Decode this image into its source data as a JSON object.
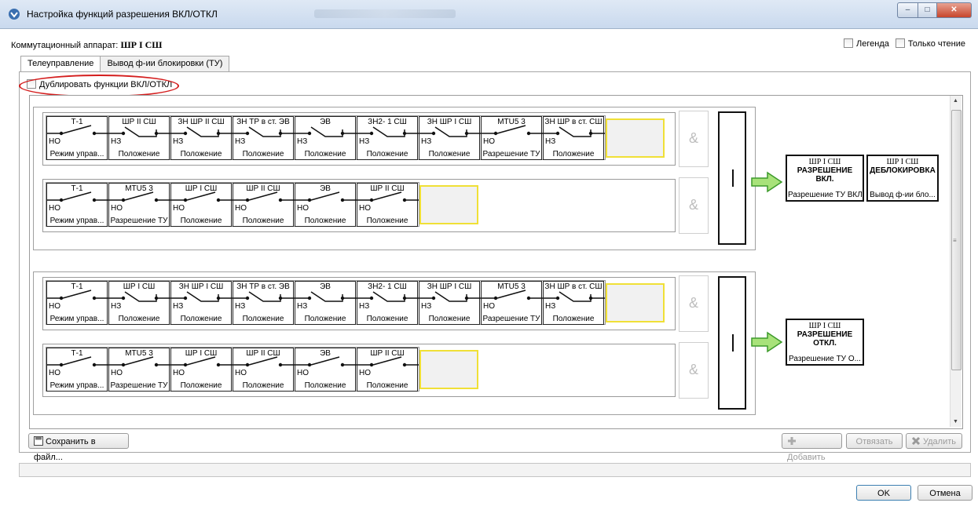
{
  "window": {
    "title": "Настройка функций разрешения ВКЛ/ОТКЛ"
  },
  "header": {
    "device_label": "Коммутационный аппарат:",
    "device_value": "ШР I СШ",
    "legend": "Легенда",
    "readonly": "Только чтение"
  },
  "tabs": [
    "Телеуправление",
    "Вывод ф-ии блокировки (ТУ)"
  ],
  "duplicate_label": "Дублировать функции ВКЛ/ОТКЛ",
  "and_symbol": "&",
  "groups": [
    {
      "rows": [
        {
          "switches": [
            {
              "name": "Т-1",
              "type": "НО",
              "desc": "Режим управ...",
              "state": "open"
            },
            {
              "name": "ШР II СШ",
              "type": "НЗ",
              "desc": "Положение",
              "state": "closed"
            },
            {
              "name": "ЗН ШР II СШ",
              "type": "НЗ",
              "desc": "Положение",
              "state": "closed"
            },
            {
              "name": "ЗН ТР в ст. ЭВ",
              "type": "НЗ",
              "desc": "Положение",
              "state": "closed"
            },
            {
              "name": "ЭВ",
              "type": "НЗ",
              "desc": "Положение",
              "state": "closed"
            },
            {
              "name": "ЗН2- 1 СШ",
              "type": "НЗ",
              "desc": "Положение",
              "state": "closed"
            },
            {
              "name": "ЗН ШР I СШ",
              "type": "НЗ",
              "desc": "Положение",
              "state": "closed"
            },
            {
              "name": "MTU5 3",
              "type": "НО",
              "desc": "Разрешение ТУ",
              "state": "open"
            },
            {
              "name": "ЗН ШР в ст. СШ",
              "type": "НЗ",
              "desc": "Положение",
              "state": "closed"
            }
          ]
        },
        {
          "switches": [
            {
              "name": "Т-1",
              "type": "НО",
              "desc": "Режим управ...",
              "state": "open"
            },
            {
              "name": "MTU5 3",
              "type": "НО",
              "desc": "Разрешение ТУ",
              "state": "open"
            },
            {
              "name": "ШР I СШ",
              "type": "НО",
              "desc": "Положение",
              "state": "open"
            },
            {
              "name": "ШР II СШ",
              "type": "НО",
              "desc": "Положение",
              "state": "open"
            },
            {
              "name": "ЭВ",
              "type": "НО",
              "desc": "Положение",
              "state": "open"
            },
            {
              "name": "ШР II СШ",
              "type": "НО",
              "desc": "Положение",
              "state": "open"
            }
          ]
        }
      ],
      "outputs": [
        {
          "name": "ШР I СШ",
          "title": "РАЗРЕШЕНИЕ ВКЛ.",
          "desc": "Разрешение ТУ ВКЛ"
        },
        {
          "name": "ШР I СШ",
          "title": "ДЕБЛОКИРОВКА",
          "desc": "Вывод ф-ии бло..."
        }
      ]
    },
    {
      "rows": [
        {
          "switches": [
            {
              "name": "Т-1",
              "type": "НО",
              "desc": "Режим управ...",
              "state": "open"
            },
            {
              "name": "ШР I СШ",
              "type": "НЗ",
              "desc": "Положение",
              "state": "closed"
            },
            {
              "name": "ЗН ШР I СШ",
              "type": "НЗ",
              "desc": "Положение",
              "state": "closed"
            },
            {
              "name": "ЗН ТР в ст. ЭВ",
              "type": "НЗ",
              "desc": "Положение",
              "state": "closed"
            },
            {
              "name": "ЭВ",
              "type": "НЗ",
              "desc": "Положение",
              "state": "closed"
            },
            {
              "name": "ЗН2- 1 СШ",
              "type": "НЗ",
              "desc": "Положение",
              "state": "closed"
            },
            {
              "name": "ЗН ШР I СШ",
              "type": "НЗ",
              "desc": "Положение",
              "state": "closed"
            },
            {
              "name": "MTU5 3",
              "type": "НО",
              "desc": "Разрешение ТУ",
              "state": "open"
            },
            {
              "name": "ЗН ШР в ст. СШ",
              "type": "НЗ",
              "desc": "Положение",
              "state": "closed"
            }
          ]
        },
        {
          "switches": [
            {
              "name": "Т-1",
              "type": "НО",
              "desc": "Режим управ...",
              "state": "open"
            },
            {
              "name": "MTU5 3",
              "type": "НО",
              "desc": "Разрешение ТУ",
              "state": "open"
            },
            {
              "name": "ШР I СШ",
              "type": "НО",
              "desc": "Положение",
              "state": "open"
            },
            {
              "name": "ШР II СШ",
              "type": "НО",
              "desc": "Положение",
              "state": "open"
            },
            {
              "name": "ЭВ",
              "type": "НО",
              "desc": "Положение",
              "state": "open"
            },
            {
              "name": "ШР II СШ",
              "type": "НО",
              "desc": "Положение",
              "state": "open"
            }
          ]
        }
      ],
      "outputs": [
        {
          "name": "ШР I СШ",
          "title": "РАЗРЕШЕНИЕ ОТКЛ.",
          "desc": "Разрешение ТУ О..."
        }
      ]
    }
  ],
  "buttons": {
    "save": "Сохранить в файл...",
    "add": "Добавить",
    "unlink": "Отвязать",
    "delete": "Удалить",
    "ok": "OK",
    "cancel": "Отмена"
  },
  "colors": {
    "arrow_fill": "#a8e27a",
    "arrow_stroke": "#3c9a2a",
    "highlight": "#d41d1d",
    "empty_slot_border": "#f0e036"
  }
}
